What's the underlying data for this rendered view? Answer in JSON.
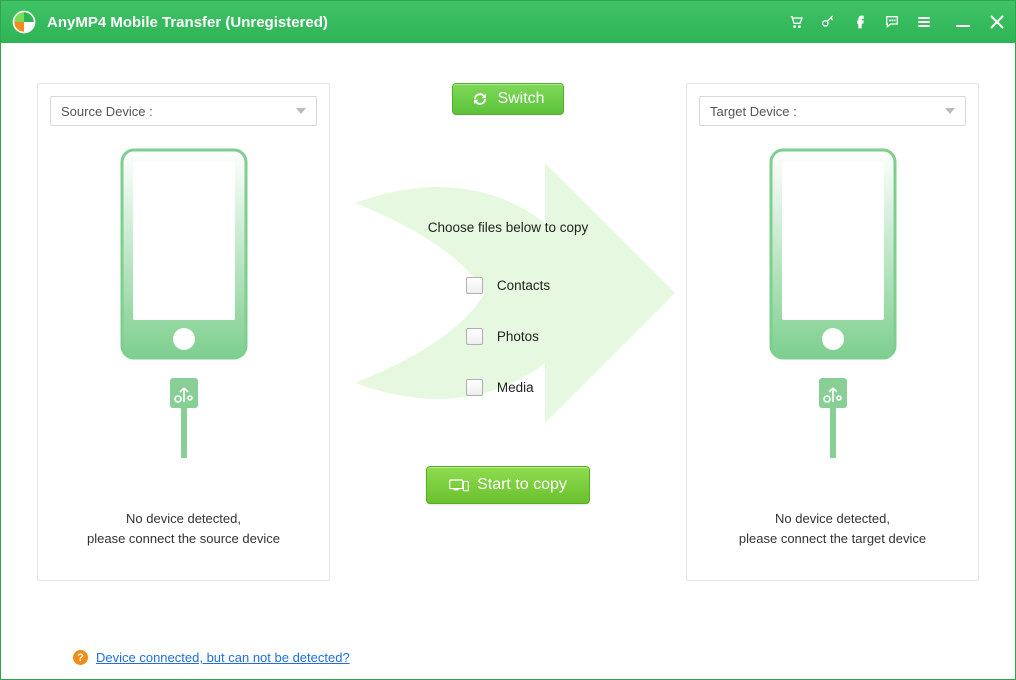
{
  "titlebar": {
    "title": "AnyMP4 Mobile Transfer (Unregistered)"
  },
  "source_panel": {
    "select_label": "Source Device :",
    "msg_line1": "No device detected,",
    "msg_line2": "please connect the source device"
  },
  "target_panel": {
    "select_label": "Target Device :",
    "msg_line1": "No device detected,",
    "msg_line2": "please connect the target device"
  },
  "middle": {
    "switch_label": "Switch",
    "choose_label": "Choose files below to copy",
    "items": {
      "contacts": "Contacts",
      "photos": "Photos",
      "media": "Media"
    },
    "start_label": "Start to copy"
  },
  "help": {
    "link_text": "Device connected, but can not be detected?"
  }
}
